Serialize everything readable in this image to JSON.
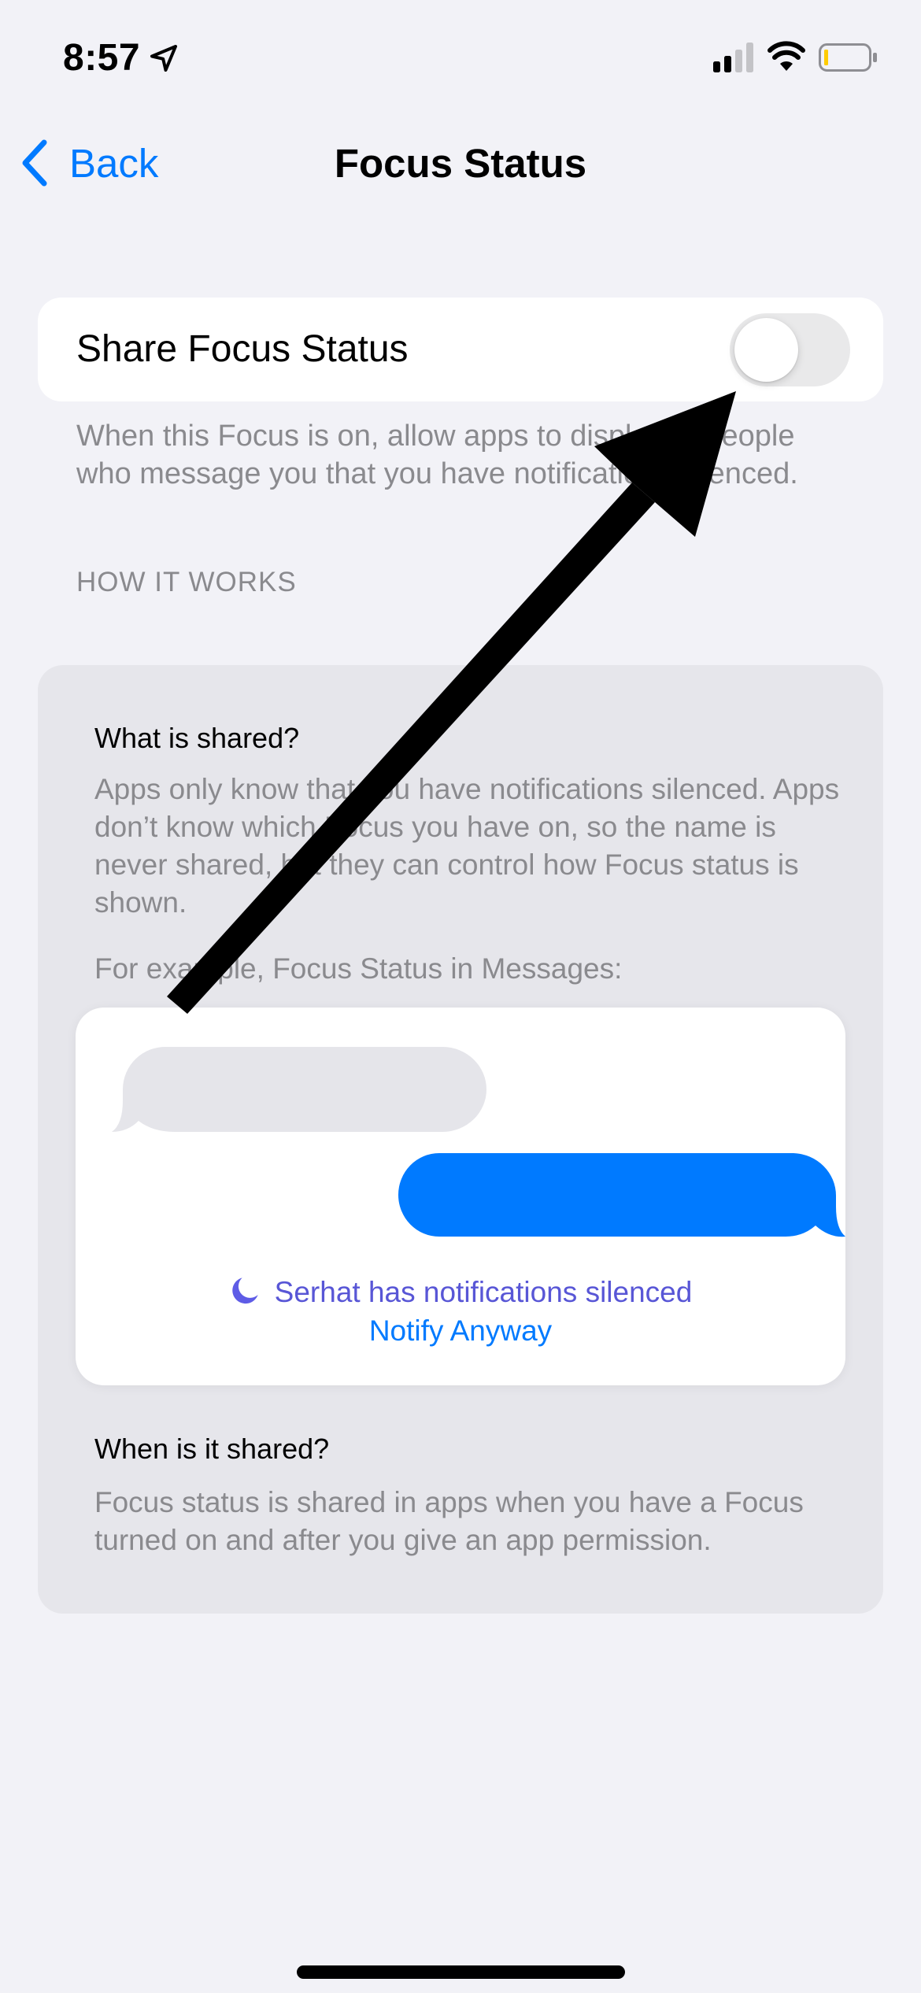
{
  "status_bar": {
    "time": "8:57",
    "signal_bars_active": 2,
    "signal_bars_total": 4,
    "battery_level": "low",
    "icons": [
      "location-arrow-icon",
      "cellular-signal-icon",
      "wifi-icon",
      "battery-icon"
    ]
  },
  "nav": {
    "back_label": "Back",
    "title": "Focus Status"
  },
  "share_setting": {
    "label": "Share Focus Status",
    "enabled": false,
    "footer": "When this Focus is on, allow apps to display to people who message you that you have notifications silenced."
  },
  "how_it_works": {
    "header": "HOW IT WORKS",
    "what_title": "What is shared?",
    "what_body": "Apps only know that you have notifications silenced. Apps don’t know which Focus you have on, so the name is never shared, but they can control how Focus status is shown.",
    "example_caption": "For example, Focus Status in Messages:",
    "preview": {
      "silenced_text": "Serhat has notifications silenced",
      "notify_link": "Notify Anyway"
    },
    "when_title": "When is it shared?",
    "when_body": "Focus status is shared in apps when you have a Focus turned on and after you give an app permission."
  },
  "colors": {
    "background": "#F2F2F7",
    "accent": "#007AFF",
    "focus_indigo": "#5856D6",
    "secondary_text": "#8A8A8E",
    "battery_low": "#FFCC00"
  },
  "annotation": {
    "type": "arrow",
    "color": "#000000",
    "points_to": "share-focus-status-toggle"
  }
}
